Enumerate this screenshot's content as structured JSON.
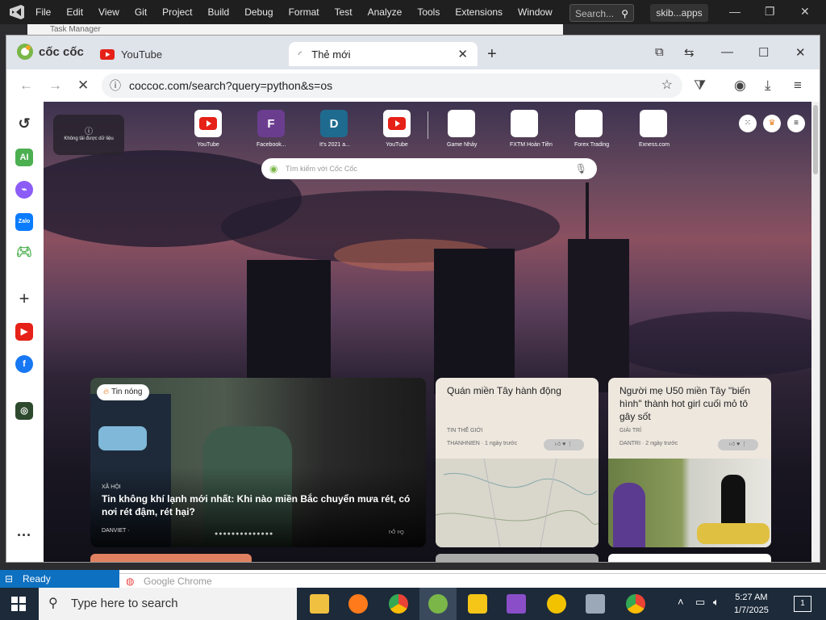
{
  "vs": {
    "menu": [
      "File",
      "Edit",
      "View",
      "Git",
      "Project",
      "Build",
      "Debug",
      "Format",
      "Test",
      "Analyze",
      "Tools",
      "Extensions",
      "Window"
    ],
    "search_placeholder": "Search...",
    "project": "skib...apps"
  },
  "taskmgr": {
    "title": "Task Manager"
  },
  "browser": {
    "brand": "cốc cốc",
    "tab_youtube": "YouTube",
    "tab_new": "Thẻ mới",
    "url": "coccoc.com/search?query=python&s=os"
  },
  "newtab": {
    "no_data": "Không tải được dữ liệu",
    "search_placeholder": "Tìm kiếm với Cốc Cốc",
    "shortcuts": [
      {
        "letter": "",
        "label": "YouTube",
        "color": "#e62117"
      },
      {
        "letter": "F",
        "label": "Facebook...",
        "color": "#6b3d8f"
      },
      {
        "letter": "D",
        "label": "It's 2021 a...",
        "color": "#1f6b8f"
      },
      {
        "letter": "",
        "label": "YouTube",
        "color": "#e62117"
      },
      {
        "letter": "",
        "label": "Game Nhảy",
        "color": "#ffffff"
      },
      {
        "letter": "",
        "label": "FXTM Hoàn Tiền",
        "color": "#ffffff"
      },
      {
        "letter": "",
        "label": "Forex Trading",
        "color": "#ffffff"
      },
      {
        "letter": "",
        "label": "Exness.com",
        "color": "#ffffff"
      }
    ],
    "hero": {
      "badge": "Tin nóng",
      "category": "XÃ HỘI",
      "title": "Tin không khí lạnh mới nhất: Khi nào miền Bắc chuyển mưa rét, có nơi rét đậm, rét hại?",
      "source": "DANVIET ·"
    },
    "card1": {
      "title": "Quán miền Tây hành động",
      "tag": "TIN THẾ GIỚI",
      "source": "THANHNIEN · 1 ngày trước"
    },
    "card2": {
      "title": "Người mẹ U50 miền Tây \"biến hình\" thành hot girl cuối mỏ tô gây sốt",
      "tag": "GIẢI TRÍ",
      "source": "DANTRI · 2 ngày trước"
    }
  },
  "status": {
    "ready": "Ready",
    "chrome": "Google Chrome"
  },
  "taskbar": {
    "search": "Type here to search",
    "time": "5:27 AM",
    "date": "1/7/2025",
    "notif": "1"
  }
}
